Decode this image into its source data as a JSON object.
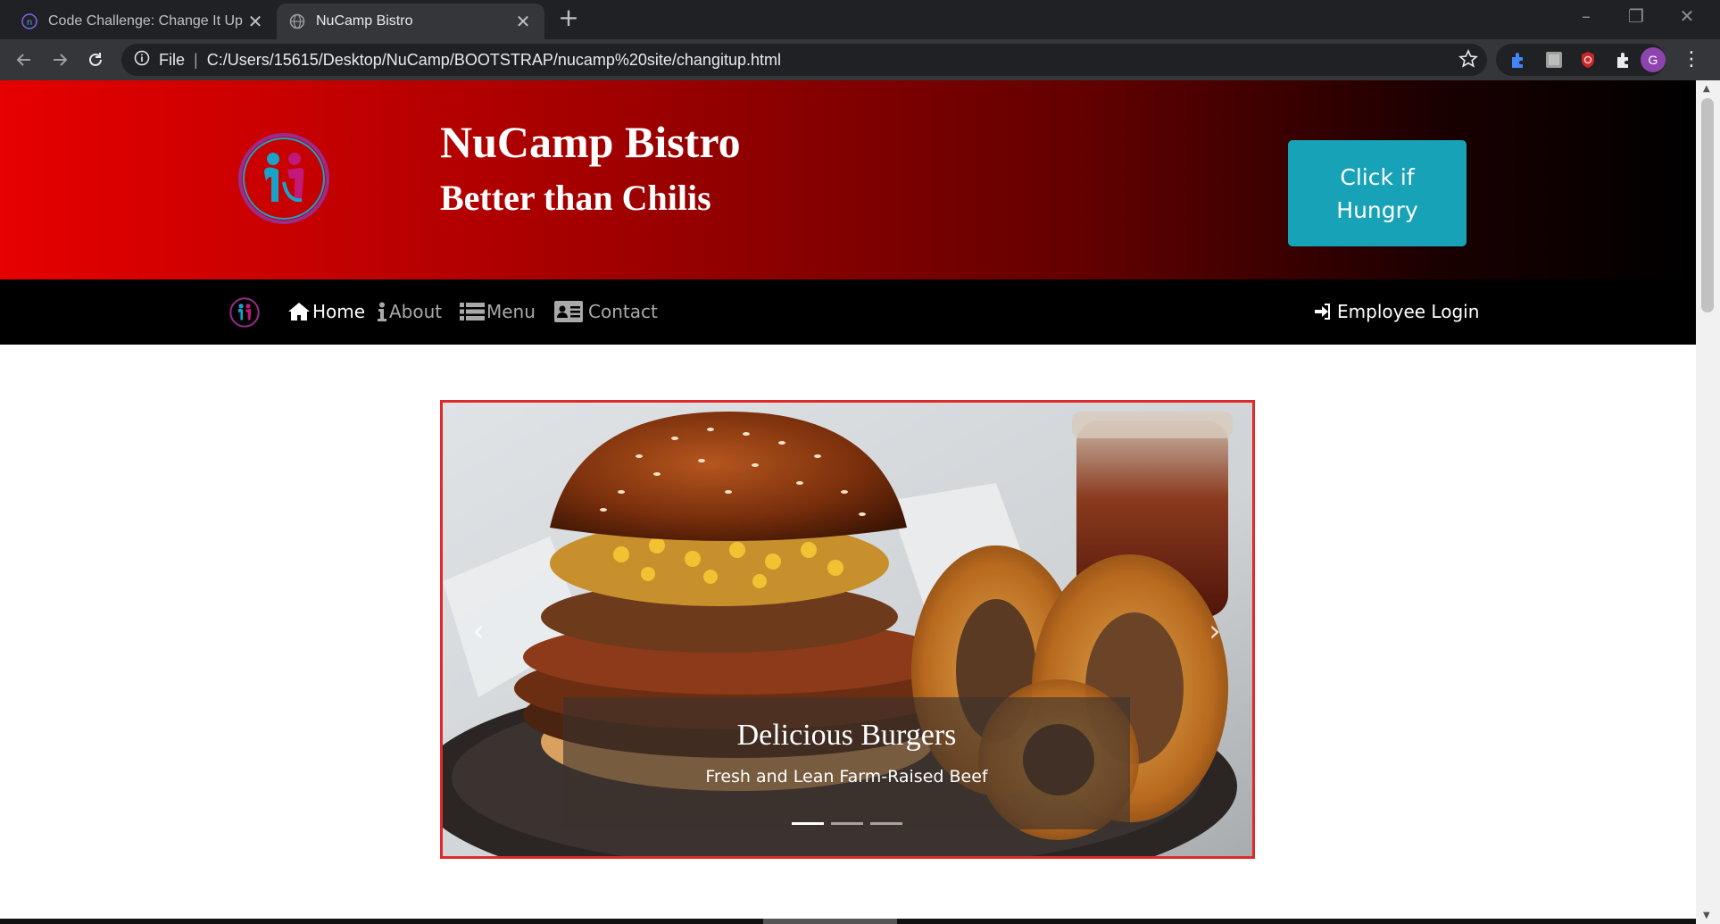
{
  "browser": {
    "tabs": [
      {
        "title": "Code Challenge: Change It Up",
        "active": false
      },
      {
        "title": "NuCamp Bistro",
        "active": true
      }
    ],
    "address": {
      "scheme": "File",
      "url": "C:/Users/15615/Desktop/NuCamp/BOOTSTRAP/nucamp%20site/changitup.html"
    },
    "profile_initial": "G"
  },
  "jumbotron": {
    "title": "NuCamp Bistro",
    "subtitle": "Better than Chilis",
    "cta_label": "Click if Hungry"
  },
  "navbar": {
    "items": [
      {
        "label": "Home",
        "icon": "home-icon",
        "active": true
      },
      {
        "label": "About",
        "icon": "info-icon",
        "active": false
      },
      {
        "label": "Menu",
        "icon": "list-icon",
        "active": false
      },
      {
        "label": "Contact",
        "icon": "address-card-icon",
        "active": false
      }
    ],
    "login_label": "Employee Login"
  },
  "carousel": {
    "caption_title": "Delicious Burgers",
    "caption_text": "Fresh and Lean Farm-Raised Beef",
    "slide_count": 3,
    "active_slide": 1,
    "border_color": "#e0292b"
  },
  "colors": {
    "cta": "#17a2b8",
    "jumbo_start": "#e60000",
    "jumbo_end": "#000000"
  }
}
